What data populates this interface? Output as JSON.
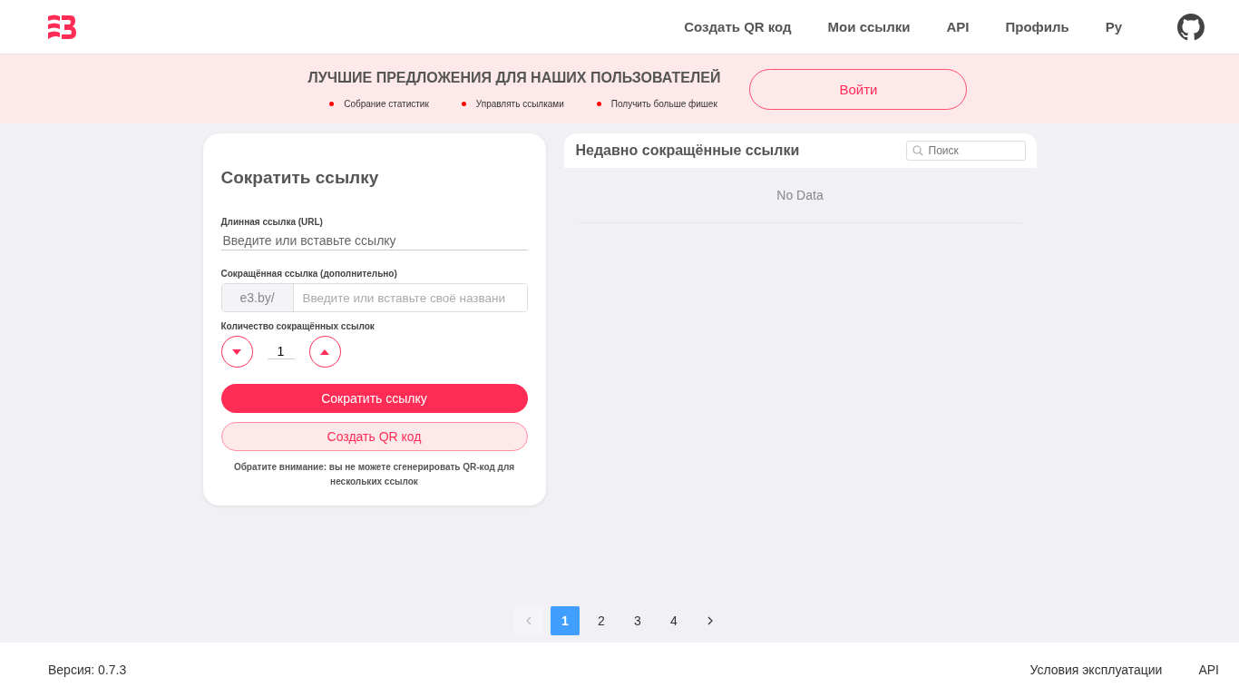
{
  "header": {
    "nav": [
      {
        "label": "Создать QR код"
      },
      {
        "label": "Мои ссылки"
      },
      {
        "label": "API"
      },
      {
        "label": "Профиль"
      },
      {
        "label": "Ру"
      }
    ]
  },
  "promo": {
    "title": "ЛУЧШИЕ ПРЕДЛОЖЕНИЯ ДЛЯ НАШИХ ПОЛЬЗОВАТЕЛЕЙ",
    "bullets": [
      "Собрание статистик",
      "Управлять ссылками",
      "Получить больше фишек"
    ],
    "button": "Войти"
  },
  "form": {
    "title": "Сократить ссылку",
    "long_label": "Длинная ссылка (URL)",
    "long_placeholder": "Введите или вставьте ссылку",
    "short_label": "Сокращённая ссылка (дополнительно)",
    "prefix": "e3.by/",
    "short_placeholder": "Введите или вставьте своё названи",
    "count_label": "Количество сокращённых ссылок",
    "count": "1",
    "submit": "Сократить ссылку",
    "qr": "Создать QR код",
    "note": "Обратите внимание: вы не можете сгенерировать QR-код для нескольких ссылок"
  },
  "recent": {
    "title": "Недавно сокращённые ссылки",
    "search_placeholder": "Поиск",
    "empty": "No Data"
  },
  "pagination": {
    "prev_disabled": true,
    "next_disabled": false,
    "pages": [
      {
        "label": "1",
        "selected": true
      },
      {
        "label": "2",
        "selected": false
      },
      {
        "label": "3",
        "selected": false
      },
      {
        "label": "4",
        "selected": false
      }
    ]
  },
  "footer": {
    "version": "Версия: 0.7.3",
    "links": [
      "Условия эксплуатации",
      "API"
    ]
  }
}
